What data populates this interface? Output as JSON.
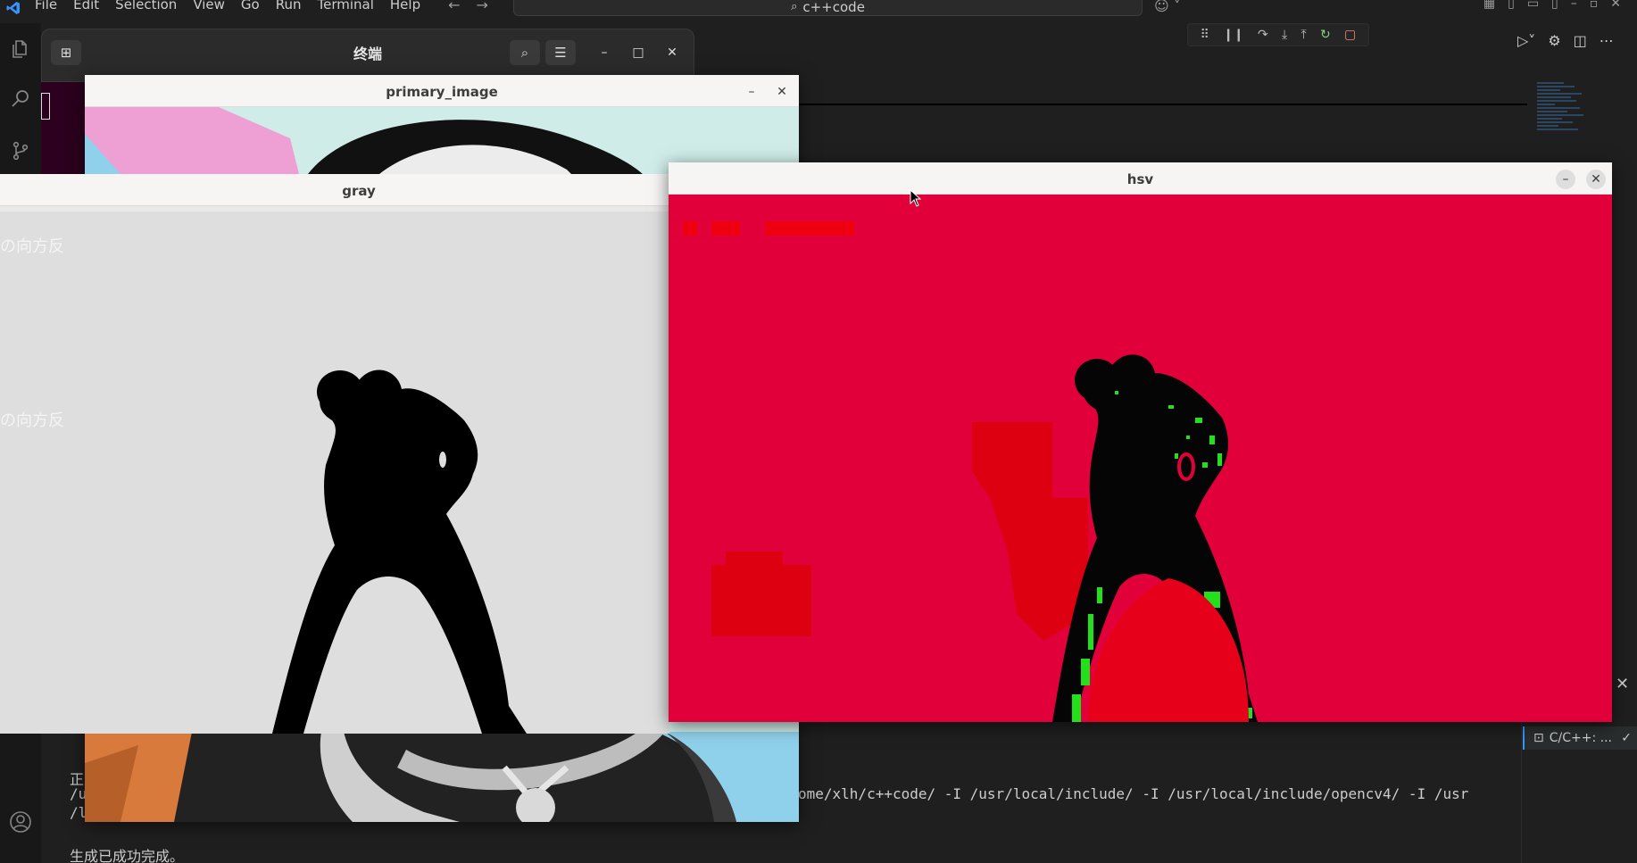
{
  "menubar": {
    "items": [
      "File",
      "Edit",
      "Selection",
      "View",
      "Go",
      "Run",
      "Terminal",
      "Help"
    ],
    "search": "c++code"
  },
  "terminal_window": {
    "title": "终端"
  },
  "windows": {
    "primary": {
      "title": "primary_image"
    },
    "gray": {
      "title": "gray",
      "overlay_text": "の向方反"
    },
    "hsv": {
      "title": "hsv"
    }
  },
  "terminal": {
    "line1_prefix": "正",
    "line2_prefix": "/u",
    "line2_suffix": "ome/xlh/c++code/ -I /usr/local/include/ -I /usr/local/include/opencv4/ -I /usr",
    "line3_prefix": "/l",
    "done": "生成已成功完成。",
    "tab_label": "C/C++: ..."
  },
  "colors": {
    "hsv_background": "#e1003a",
    "gray_background": "#dedede",
    "accent": "#3794ff"
  }
}
